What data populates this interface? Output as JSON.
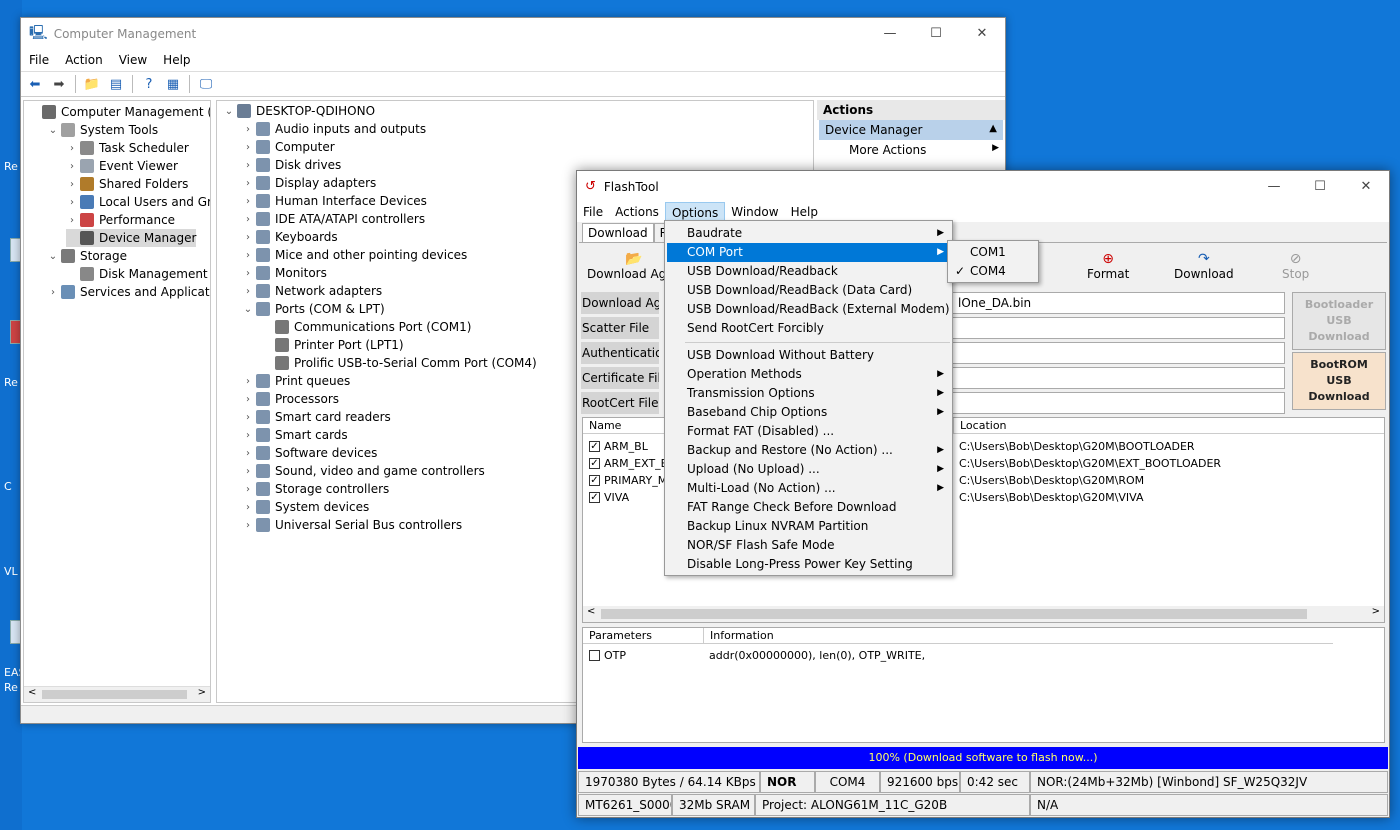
{
  "desktop": {
    "labels": [
      "Re",
      "Re",
      "C",
      "VL",
      "EAS",
      "Re"
    ]
  },
  "cm": {
    "title": "Computer Management",
    "menu": [
      "File",
      "Action",
      "View",
      "Help"
    ],
    "left_tree": [
      {
        "label": "Computer Management (Local",
        "level": 0
      },
      {
        "label": "System Tools",
        "level": 1
      },
      {
        "label": "Task Scheduler",
        "level": 2
      },
      {
        "label": "Event Viewer",
        "level": 2
      },
      {
        "label": "Shared Folders",
        "level": 2
      },
      {
        "label": "Local Users and Groups",
        "level": 2
      },
      {
        "label": "Performance",
        "level": 2
      },
      {
        "label": "Device Manager",
        "level": 2
      },
      {
        "label": "Storage",
        "level": 1
      },
      {
        "label": "Disk Management",
        "level": 2
      },
      {
        "label": "Services and Applications",
        "level": 1
      }
    ],
    "device_tree": [
      {
        "label": "DESKTOP-QDIHONO",
        "level": 0
      },
      {
        "label": "Audio inputs and outputs",
        "level": 1
      },
      {
        "label": "Computer",
        "level": 1
      },
      {
        "label": "Disk drives",
        "level": 1
      },
      {
        "label": "Display adapters",
        "level": 1
      },
      {
        "label": "Human Interface Devices",
        "level": 1
      },
      {
        "label": "IDE ATA/ATAPI controllers",
        "level": 1
      },
      {
        "label": "Keyboards",
        "level": 1
      },
      {
        "label": "Mice and other pointing devices",
        "level": 1
      },
      {
        "label": "Monitors",
        "level": 1
      },
      {
        "label": "Network adapters",
        "level": 1
      },
      {
        "label": "Ports (COM & LPT)",
        "level": 1
      },
      {
        "label": "Communications Port (COM1)",
        "level": 2
      },
      {
        "label": "Printer Port (LPT1)",
        "level": 2
      },
      {
        "label": "Prolific USB-to-Serial Comm Port (COM4)",
        "level": 2
      },
      {
        "label": "Print queues",
        "level": 1
      },
      {
        "label": "Processors",
        "level": 1
      },
      {
        "label": "Smart card readers",
        "level": 1
      },
      {
        "label": "Smart cards",
        "level": 1
      },
      {
        "label": "Software devices",
        "level": 1
      },
      {
        "label": "Sound, video and game controllers",
        "level": 1
      },
      {
        "label": "Storage controllers",
        "level": 1
      },
      {
        "label": "System devices",
        "level": 1
      },
      {
        "label": "Universal Serial Bus controllers",
        "level": 1
      }
    ],
    "actions": {
      "header": "Actions",
      "selected": "Device Manager",
      "more": "More Actions"
    }
  },
  "ft": {
    "title": "FlashTool",
    "menu": [
      "File",
      "Actions",
      "Options",
      "Window",
      "Help"
    ],
    "tabs": [
      "Download",
      "Rea"
    ],
    "buttons": {
      "download_agent": "Download Agen",
      "format": "Format",
      "download": "Download",
      "stop": "Stop"
    },
    "fields": [
      {
        "label": "Download Agent",
        "value": "lOne_DA.bin"
      },
      {
        "label": "Scatter File",
        "value": ""
      },
      {
        "label": "Authentication Fil",
        "value": ""
      },
      {
        "label": "Certificate File",
        "value": ""
      },
      {
        "label": "RootCert File",
        "value": ""
      }
    ],
    "bootloader_btn": [
      "Bootloader",
      "USB",
      "Download"
    ],
    "bootrom_btn": [
      "BootROM",
      "USB",
      "Download"
    ],
    "grid": {
      "col_name": "Name",
      "col_location": "Location",
      "rows": [
        {
          "name": "ARM_BL",
          "location": "C:\\Users\\Bob\\Desktop\\G20M\\BOOTLOADER"
        },
        {
          "name": "ARM_EXT_B",
          "location": "C:\\Users\\Bob\\Desktop\\G20M\\EXT_BOOTLOADER"
        },
        {
          "name": "PRIMARY_M",
          "location": "C:\\Users\\Bob\\Desktop\\G20M\\ROM"
        },
        {
          "name": "VIVA",
          "location": "C:\\Users\\Bob\\Desktop\\G20M\\VIVA"
        }
      ]
    },
    "params": {
      "col_params": "Parameters",
      "col_info": "Information",
      "row_name": "OTP",
      "row_info": "addr(0x00000000), len(0), OTP_WRITE,"
    },
    "progress": "100% (Download software to flash now...)",
    "status1": [
      "1970380 Bytes / 64.14 KBps",
      "NOR",
      "COM4",
      "921600 bps",
      "0:42 sec",
      "NOR:(24Mb+32Mb) [Winbond] SF_W25Q32JV"
    ],
    "status2": [
      "MT6261_S0000",
      "32Mb SRAM",
      "Project: ALONG61M_11C_G20B",
      "N/A"
    ]
  },
  "options_menu": {
    "items": [
      {
        "label": "Baudrate",
        "sub": true
      },
      {
        "label": "COM Port",
        "sub": true,
        "hl": true
      },
      {
        "label": "USB Download/Readback"
      },
      {
        "label": "USB Download/ReadBack (Data Card)"
      },
      {
        "label": "USB Download/ReadBack (External Modem)"
      },
      {
        "label": "Send RootCert Forcibly"
      },
      {
        "sep": true
      },
      {
        "label": "USB Download Without Battery"
      },
      {
        "label": "Operation Methods",
        "sub": true
      },
      {
        "label": "Transmission Options",
        "sub": true
      },
      {
        "label": "Baseband Chip Options",
        "sub": true
      },
      {
        "label": "Format FAT (Disabled) ..."
      },
      {
        "label": "Backup and Restore (No Action) ...",
        "sub": true
      },
      {
        "label": "Upload (No Upload) ...",
        "sub": true
      },
      {
        "label": "Multi-Load (No Action) ...",
        "sub": true
      },
      {
        "label": "FAT Range Check Before Download"
      },
      {
        "label": "Backup Linux NVRAM Partition"
      },
      {
        "label": "NOR/SF Flash Safe Mode"
      },
      {
        "label": "Disable Long-Press Power Key Setting"
      }
    ],
    "com_submenu": [
      {
        "label": "COM1",
        "checked": false
      },
      {
        "label": "COM4",
        "checked": true
      }
    ]
  }
}
